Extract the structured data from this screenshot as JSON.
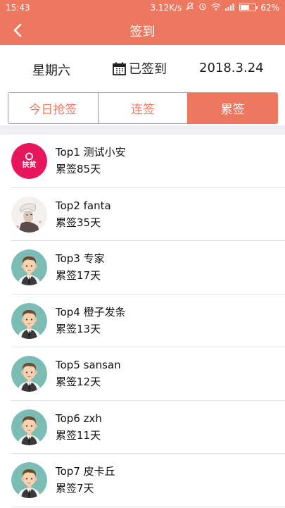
{
  "status_bar": {
    "time": "15:43",
    "speed": "3.12K/s",
    "battery": "62%",
    "battery_level": 0.62
  },
  "nav": {
    "title": "签到"
  },
  "info": {
    "weekday": "星期六",
    "sign_status": "已签到",
    "date": "2018.3.24"
  },
  "tabs": [
    {
      "label": "今日抢签",
      "active": false
    },
    {
      "label": "连签",
      "active": false
    },
    {
      "label": "累签",
      "active": true
    }
  ],
  "colors": {
    "accent": "#ee7760",
    "avatar_bg": "#7bbdb4",
    "brand_pink": "#e8175d"
  },
  "ranking": [
    {
      "name": "Top1 测试小安",
      "count": "累签85天",
      "avatar": "brand-logo-avatar",
      "logo_text": "扶贫"
    },
    {
      "name": "Top2 fanta",
      "count": "累签35天",
      "avatar": "photo-avatar"
    },
    {
      "name": "Top3 专家",
      "count": "累签17天",
      "avatar": "default-man-avatar"
    },
    {
      "name": "Top4 橙子发条",
      "count": "累签13天",
      "avatar": "default-man-avatar"
    },
    {
      "name": "Top5 sansan",
      "count": "累签12天",
      "avatar": "default-man-avatar"
    },
    {
      "name": "Top6 zxh",
      "count": "累签11天",
      "avatar": "default-man-avatar"
    },
    {
      "name": "Top7 皮卡丘",
      "count": "累签7天",
      "avatar": "default-man-avatar"
    }
  ]
}
